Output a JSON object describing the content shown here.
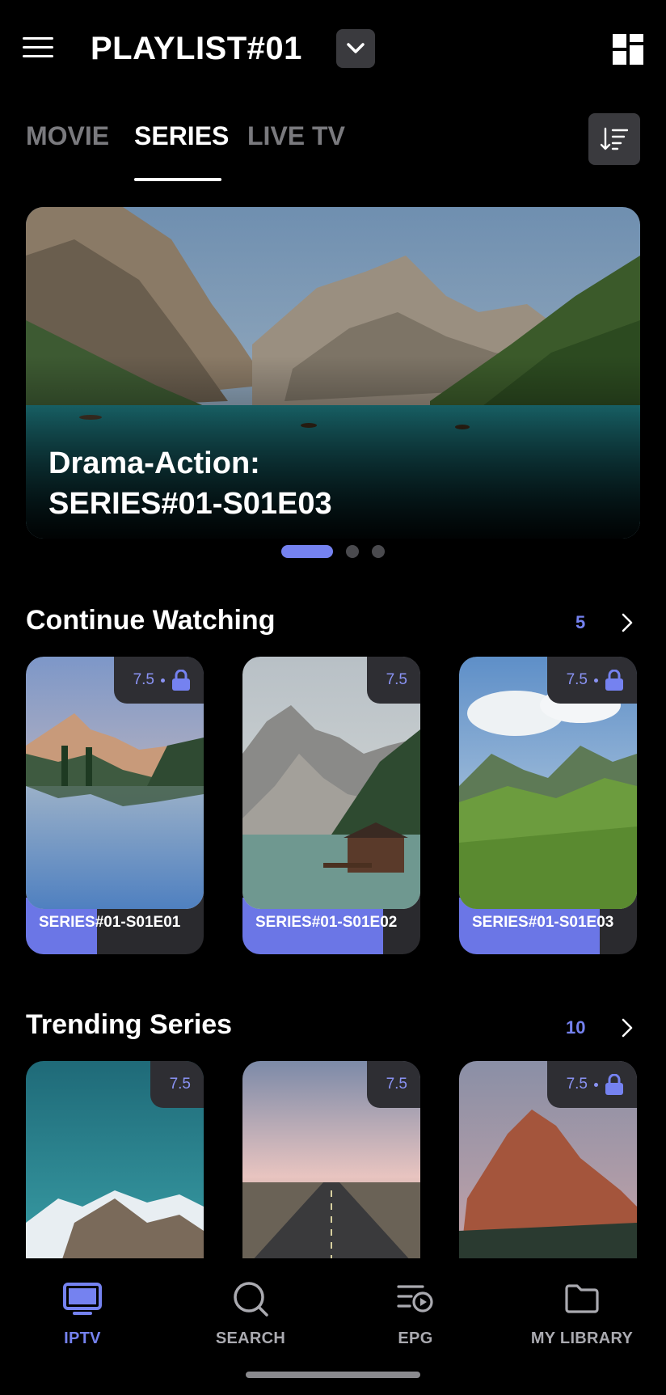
{
  "header": {
    "title": "PLAYLIST#01",
    "menu_icon": "hamburger-menu-icon",
    "dropdown_icon": "chevron-down-icon",
    "grid_icon": "grid-layout-icon"
  },
  "tabs": [
    {
      "label": "MOVIE",
      "active": false
    },
    {
      "label": "SERIES",
      "active": true
    },
    {
      "label": "LIVE TV",
      "active": false
    }
  ],
  "sort_icon": "sort-icon",
  "hero": {
    "title_line1": "Drama-Action:",
    "title_line2": "SERIES#01-S01E03",
    "pages": 3,
    "current_page": 1
  },
  "continue_watching": {
    "title": "Continue Watching",
    "count": "5",
    "items": [
      {
        "title": "SERIES#01-S01E01",
        "rating": "7.5",
        "locked": true,
        "progress": 0.4
      },
      {
        "title": "SERIES#01-S01E02",
        "rating": "7.5",
        "locked": false,
        "progress": 0.79
      },
      {
        "title": "SERIES#01-S01E03",
        "rating": "7.5",
        "locked": true,
        "progress": 0.79
      }
    ]
  },
  "trending_series": {
    "title": "Trending Series",
    "count": "10",
    "items": [
      {
        "rating": "7.5",
        "locked": false
      },
      {
        "rating": "7.5",
        "locked": false
      },
      {
        "rating": "7.5",
        "locked": true
      }
    ]
  },
  "bottom_nav": [
    {
      "label": "IPTV",
      "icon": "tv-icon",
      "active": true
    },
    {
      "label": "SEARCH",
      "icon": "search-icon",
      "active": false
    },
    {
      "label": "EPG",
      "icon": "epg-icon",
      "active": false
    },
    {
      "label": "MY LIBRARY",
      "icon": "folder-icon",
      "active": false
    }
  ],
  "colors": {
    "accent": "#7582f0",
    "background": "#000000",
    "surface": "#3a3a3e"
  }
}
